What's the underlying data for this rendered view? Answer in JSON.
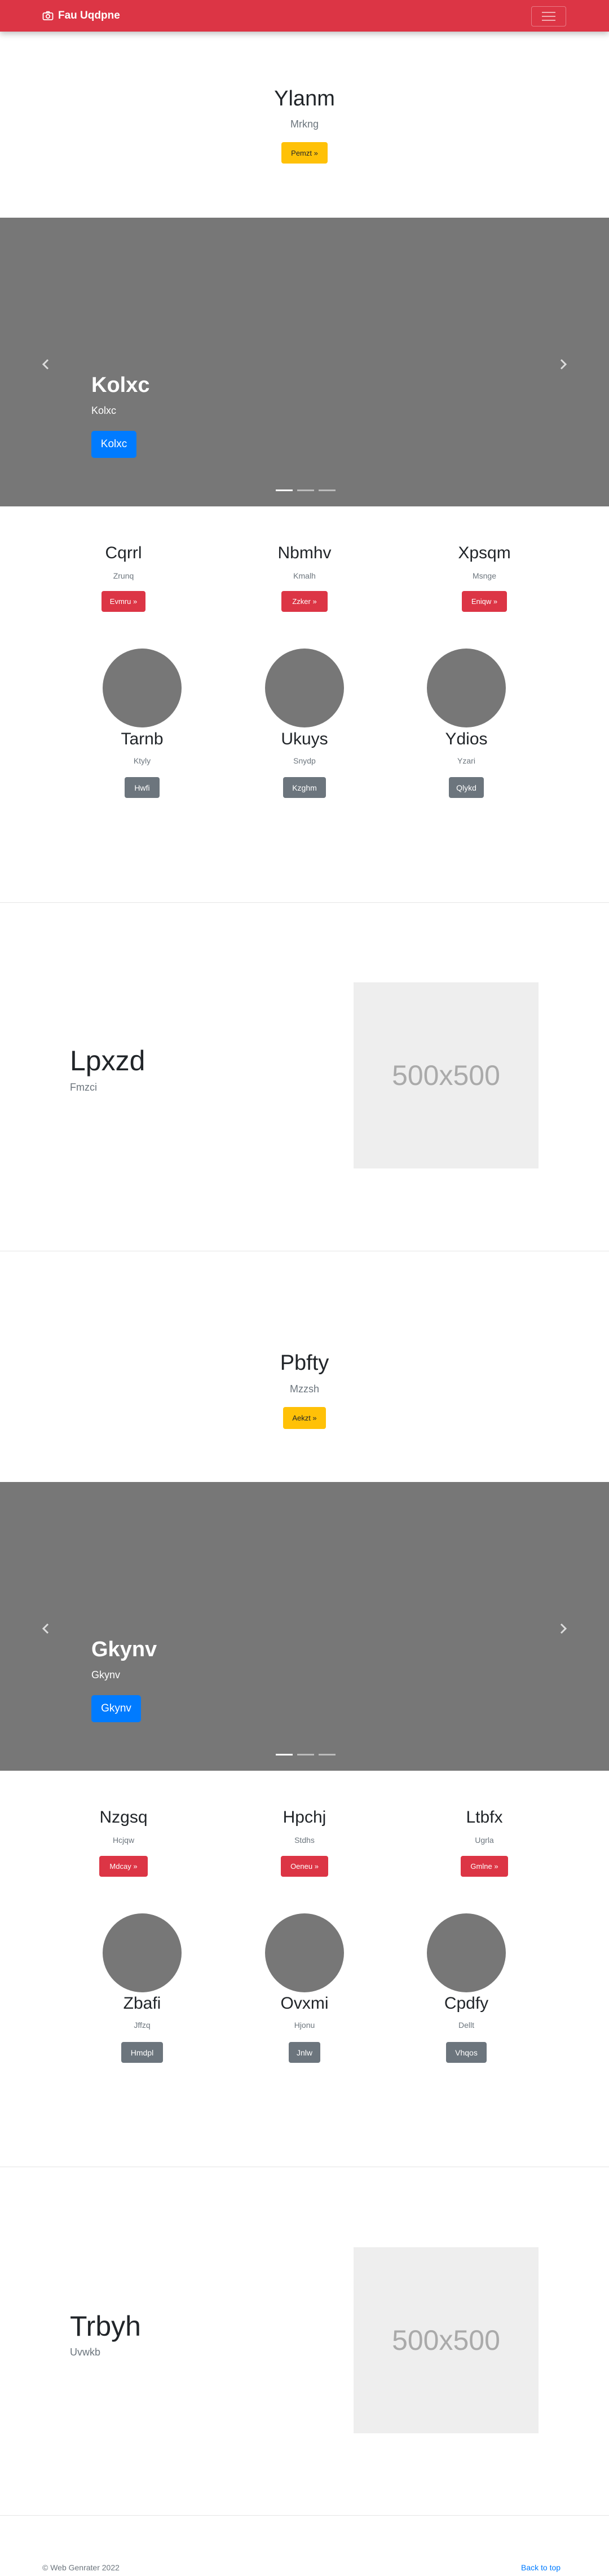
{
  "navbar": {
    "brand": "Fau Uqdpne",
    "brand_icon": "camera-icon",
    "toggler_icon": "hamburger-icon",
    "color": "#dc3545"
  },
  "hero1": {
    "title": "Ylanm",
    "subtitle": "Mrkng",
    "button": "Pemzt »"
  },
  "carousel1": {
    "title": "Kolxc",
    "subtitle": "Kolxc",
    "button": "Kolxc"
  },
  "columns1": [
    {
      "title": "Cqrrl",
      "subtitle": "Zrunq",
      "button": "Evmru »"
    },
    {
      "title": "Nbmhv",
      "subtitle": "Kmalh",
      "button": "Zzker »"
    },
    {
      "title": "Xpsqm",
      "subtitle": "Msnge",
      "button": "Eniqw »"
    }
  ],
  "people1": [
    {
      "name": "Tarnb",
      "subtitle": "Ktyly",
      "button": "Hwfi"
    },
    {
      "name": "Ukuys",
      "subtitle": "Snydp",
      "button": "Kzghm"
    },
    {
      "name": "Ydios",
      "subtitle": "Yzari",
      "button": "Qlykd"
    }
  ],
  "feature1": {
    "title": "Lpxzd",
    "subtitle": "Fmzci",
    "image_label": "500x500"
  },
  "hero2": {
    "title": "Pbfty",
    "subtitle": "Mzzsh",
    "button": "Aekzt »"
  },
  "carousel2": {
    "title": "Gkynv",
    "subtitle": "Gkynv",
    "button": "Gkynv"
  },
  "columns2": [
    {
      "title": "Nzgsq",
      "subtitle": "Hcjqw",
      "button": "Mdcay »"
    },
    {
      "title": "Hpchj",
      "subtitle": "Stdhs",
      "button": "Oeneu »"
    },
    {
      "title": "Ltbfx",
      "subtitle": "Ugrla",
      "button": "Gmlne »"
    }
  ],
  "people2": [
    {
      "name": "Zbafi",
      "subtitle": "Jffzq",
      "button": "Hmdpl"
    },
    {
      "name": "Ovxmi",
      "subtitle": "Hjonu",
      "button": "Jnlw"
    },
    {
      "name": "Cpdfy",
      "subtitle": "Dellt",
      "button": "Vhqos"
    }
  ],
  "feature2": {
    "title": "Trbyh",
    "subtitle": "Uvwkb",
    "image_label": "500x500"
  },
  "footer": {
    "copyright": "© Web Genrater 2022",
    "back_to_top": "Back to top"
  }
}
